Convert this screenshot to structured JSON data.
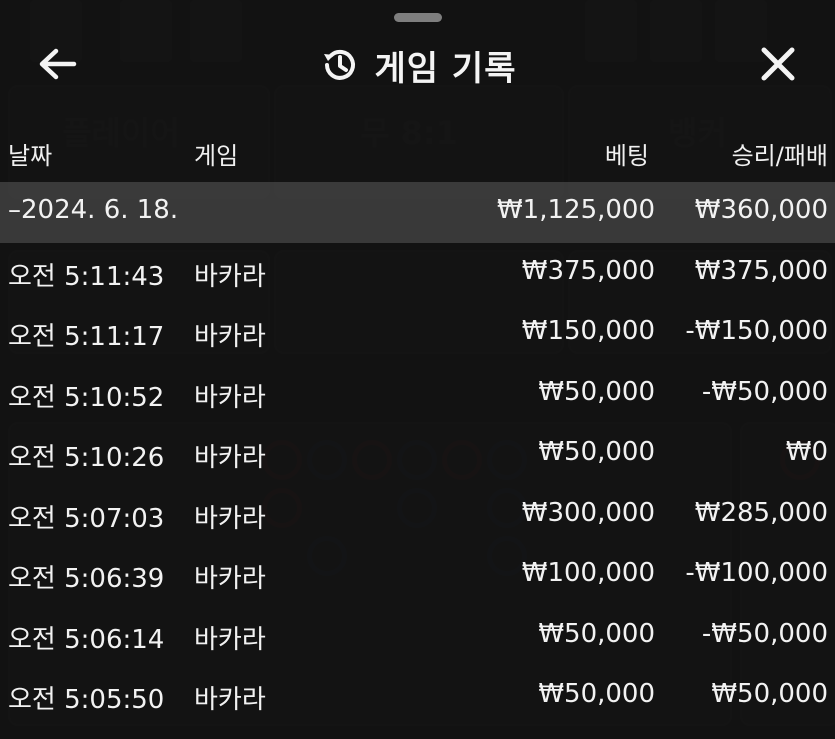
{
  "header": {
    "title": "게임 기록",
    "back_icon": "arrow-left-icon",
    "history_icon": "history-clock-icon",
    "close_icon": "close-icon"
  },
  "columns": {
    "date": "날짜",
    "game": "게임",
    "bet": "베팅",
    "result": "승리/패배"
  },
  "summary": {
    "date": "–2024. 6. 18.",
    "bet": "₩1,125,000",
    "result": "₩360,000"
  },
  "rows": [
    {
      "time": "오전 5:11:43",
      "game": "바카라",
      "bet": "₩375,000",
      "result": "₩375,000"
    },
    {
      "time": "오전 5:11:17",
      "game": "바카라",
      "bet": "₩150,000",
      "result": "-₩150,000"
    },
    {
      "time": "오전 5:10:52",
      "game": "바카라",
      "bet": "₩50,000",
      "result": "-₩50,000"
    },
    {
      "time": "오전 5:10:26",
      "game": "바카라",
      "bet": "₩50,000",
      "result": "₩0"
    },
    {
      "time": "오전 5:07:03",
      "game": "바카라",
      "bet": "₩300,000",
      "result": "₩285,000"
    },
    {
      "time": "오전 5:06:39",
      "game": "바카라",
      "bet": "₩100,000",
      "result": "-₩100,000"
    },
    {
      "time": "오전 5:06:14",
      "game": "바카라",
      "bet": "₩50,000",
      "result": "-₩50,000"
    },
    {
      "time": "오전 5:05:50",
      "game": "바카라",
      "bet": "₩50,000",
      "result": "₩50,000"
    }
  ],
  "background": {
    "left_word": "플레이어",
    "center_word": "무 8:1",
    "right_word": "뱅커"
  },
  "colors": {
    "overlay": "#121212",
    "summary_row": "#4a4a4a",
    "text": "#f2f2f2"
  }
}
